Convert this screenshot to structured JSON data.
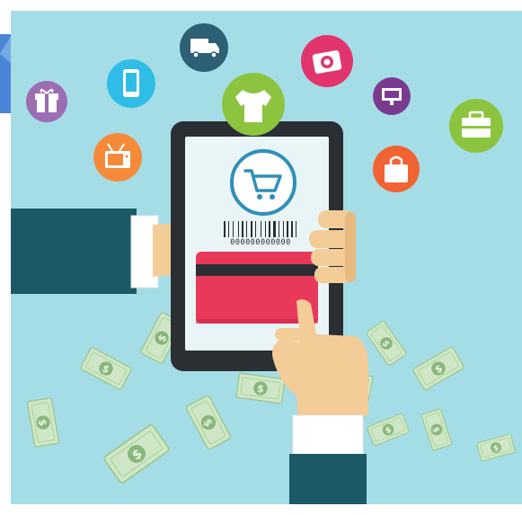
{
  "illustration": {
    "barcode_number": "000000000000",
    "colors": {
      "background": "#a5dde6",
      "tablet_frame": "#2b2e33",
      "screen": "#e9f4f6",
      "cart_accent": "#2f8fb9",
      "card": "#e8395a",
      "card_stripe": "#2b2e33",
      "sleeve": "#1b5966",
      "skin": "#f3cc98",
      "money": "#cfe7c6",
      "money_dark": "#8ab67b"
    },
    "floating_icons": [
      {
        "name": "truck-icon",
        "color": "#2e6075"
      },
      {
        "name": "camera-icon",
        "color": "#e2346d"
      },
      {
        "name": "smartphone-icon",
        "color": "#2fbde7"
      },
      {
        "name": "gift-icon",
        "color": "#9c6db3"
      },
      {
        "name": "tshirt-icon",
        "color": "#8dc43f"
      },
      {
        "name": "monitor-icon",
        "color": "#7a3b8f"
      },
      {
        "name": "briefcase-icon",
        "color": "#8dc43f"
      },
      {
        "name": "tv-icon",
        "color": "#f58b3a"
      },
      {
        "name": "shopping-bag-icon",
        "color": "#f26333"
      }
    ],
    "corner_fragment_color": "#4a86d8"
  }
}
